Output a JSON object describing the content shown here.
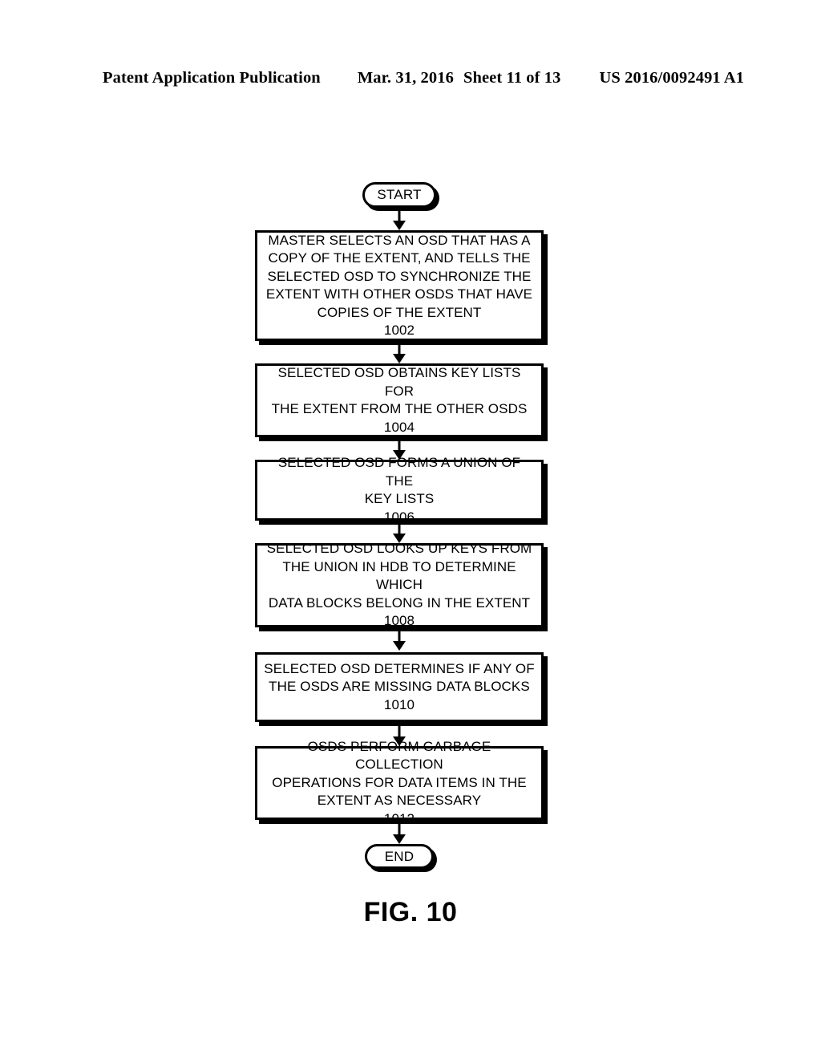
{
  "header": {
    "publication": "Patent Application Publication",
    "date": "Mar. 31, 2016",
    "sheet": "Sheet 11 of 13",
    "patent_number": "US 2016/0092491 A1"
  },
  "figure": {
    "caption": "FIG. 10"
  },
  "flowchart": {
    "start_label": "START",
    "end_label": "END",
    "steps": [
      {
        "text": "MASTER SELECTS AN OSD THAT HAS A\nCOPY OF THE EXTENT, AND TELLS THE\nSELECTED OSD TO SYNCHRONIZE THE\nEXTENT WITH OTHER OSDS THAT HAVE\nCOPIES OF THE EXTENT",
        "ref": "1002"
      },
      {
        "text": "SELECTED OSD OBTAINS KEY LISTS FOR\nTHE EXTENT FROM THE OTHER OSDS",
        "ref": "1004"
      },
      {
        "text": "SELECTED OSD FORMS A UNION OF THE\nKEY LISTS",
        "ref": "1006"
      },
      {
        "text": "SELECTED OSD LOOKS UP KEYS FROM\nTHE UNION IN HDB TO DETERMINE WHICH\nDATA BLOCKS BELONG IN THE EXTENT",
        "ref": "1008"
      },
      {
        "text": "SELECTED OSD DETERMINES IF ANY OF\nTHE OSDS ARE MISSING DATA BLOCKS",
        "ref": "1010"
      },
      {
        "text": "OSDS PERFORM GARBAGE COLLECTION\nOPERATIONS FOR DATA ITEMS IN THE\nEXTENT AS NECESSARY",
        "ref": "1012"
      }
    ]
  }
}
